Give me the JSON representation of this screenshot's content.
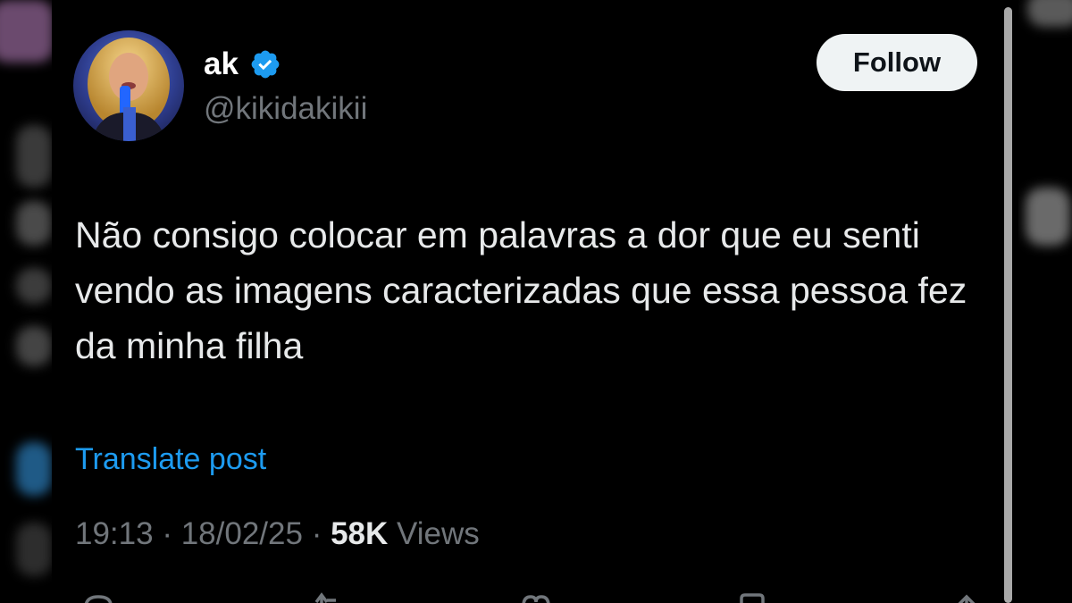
{
  "author": {
    "display_name": "ak",
    "handle": "@kikidakikii",
    "verified": true,
    "avatar_icon": "profile-photo"
  },
  "follow_button": {
    "label": "Follow"
  },
  "tweet": {
    "text": "Não consigo colocar em palavras a dor que eu senti vendo as imagens caracterizadas que essa pessoa fez da minha filha",
    "translate_label": "Translate post"
  },
  "meta": {
    "time": "19:13",
    "date": "18/02/25",
    "separator": "·",
    "views_count": "58K",
    "views_label": "Views"
  },
  "actions": {
    "icons": [
      "reply-icon",
      "repost-icon",
      "like-icon",
      "bookmark-icon",
      "share-icon"
    ]
  },
  "colors": {
    "background": "#000000",
    "text_primary": "#e7e9ea",
    "text_secondary": "#71767b",
    "accent_blue": "#1d9bf0",
    "follow_bg": "#eff3f4"
  }
}
